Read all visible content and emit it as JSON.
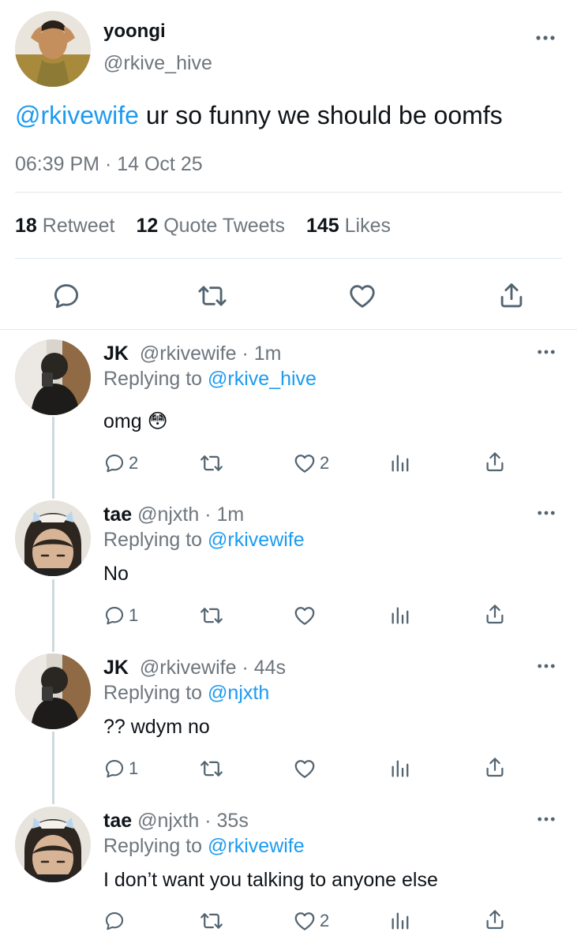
{
  "main_tweet": {
    "name": "yoongi",
    "handle": "@rkive_hive",
    "mention": "@rkivewife",
    "text": " ur so funny we should be oomfs",
    "timestamp": "06:39 PM · 14 Oct 25",
    "stats": {
      "retweets": "18",
      "retweets_label": "Retweet",
      "quotes": "12",
      "quotes_label": "Quote Tweets",
      "likes": "145",
      "likes_label": "Likes"
    }
  },
  "replies": [
    {
      "name": "JK",
      "handle": "@rkivewife",
      "time": "· 1m",
      "replying_prefix": "Replying to ",
      "replying_to": "@rkive_hive",
      "text": "omg 😳",
      "reply_count": "2",
      "retweet_count": "",
      "like_count": "2"
    },
    {
      "name": "tae",
      "handle": "@njxth",
      "time": "· 1m",
      "replying_prefix": "Replying to ",
      "replying_to": "@rkivewife",
      "text": "No",
      "reply_count": "1",
      "retweet_count": "",
      "like_count": ""
    },
    {
      "name": "JK",
      "handle": "@rkivewife",
      "time": "· 44s",
      "replying_prefix": "Replying to ",
      "replying_to": "@njxth",
      "text": "?? wdym no",
      "reply_count": "1",
      "retweet_count": "",
      "like_count": ""
    },
    {
      "name": "tae",
      "handle": "@njxth",
      "time": "· 35s",
      "replying_prefix": "Replying to ",
      "replying_to": "@rkivewife",
      "text": "I don’t want you talking to anyone else",
      "reply_count": "",
      "retweet_count": "",
      "like_count": "2"
    }
  ],
  "colors": {
    "accent": "#1d9bf0",
    "secondary_text": "#6e767d",
    "icon": "#536471",
    "divider": "#e1e8ed"
  },
  "icons": [
    "reply-icon",
    "retweet-icon",
    "like-icon",
    "share-icon",
    "analytics-icon",
    "more-icon"
  ]
}
